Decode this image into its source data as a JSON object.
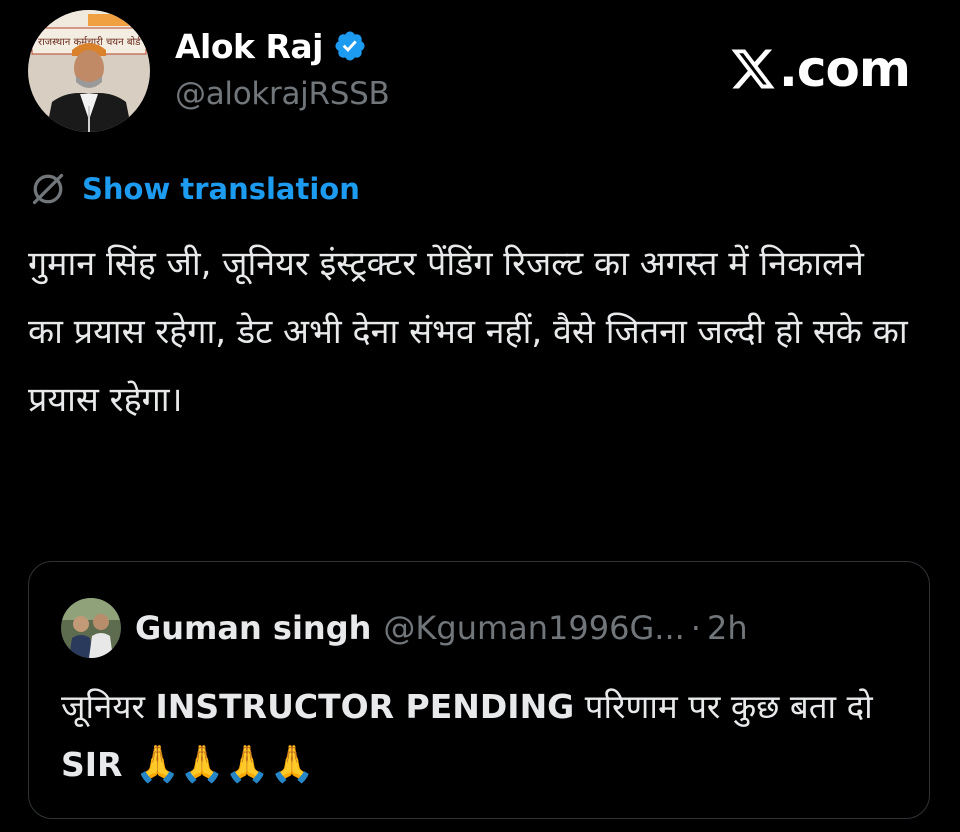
{
  "tweet": {
    "author_name": "Alok Raj",
    "author_handle": "@alokrajRSSB",
    "verified_icon": "verified-badge-icon",
    "site_label": ".com",
    "site_icon": "x-logo-icon",
    "translate_label": "Show translation",
    "text": "गुमान सिंह जी, जूनियर इंस्ट्रक्टर पेंडिंग रिजल्ट का अगस्त में निकालने का प्रयास रहेगा, डेट अभी देना संभव नहीं, वैसे जितना जल्दी हो सके का प्रयास रहेगा।",
    "avatar_sign_text": "राजस्थान कर्मचारी चयन बोर्ड"
  },
  "quote": {
    "author_name": "Guman singh",
    "author_handle": "@Kguman1996G...",
    "separator": "·",
    "time": "2h",
    "text_part1": "जूनियर ",
    "text_bold": "INSTRUCTOR PENDING",
    "text_part2": " परिणाम पर कुछ बता दो ",
    "text_bold2": "SIR",
    "emoji": "🙏🙏🙏🙏"
  },
  "colors": {
    "background": "#000000",
    "accent": "#1d9bf0",
    "muted": "#71767b",
    "text": "#e7e9ea",
    "border": "#2f3336"
  }
}
